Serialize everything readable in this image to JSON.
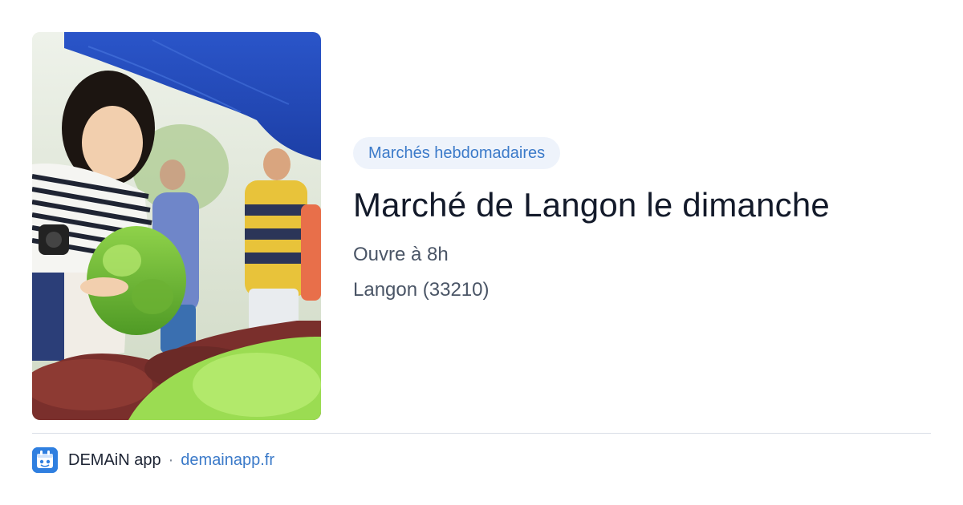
{
  "image": {
    "description_icon": "market-photo-image"
  },
  "badge": {
    "label": "Marchés hebdomadaires"
  },
  "title": "Marché de Langon le dimanche",
  "hours": "Ouvre à 8h",
  "location": "Langon (33210)",
  "footer": {
    "app_name": "DEMAiN app",
    "separator": "·",
    "domain": "demainapp.fr"
  },
  "colors": {
    "accent": "#3b7ac9",
    "badge_background": "#eef3fb",
    "title": "#131a2a",
    "body_text": "#4a5566"
  }
}
